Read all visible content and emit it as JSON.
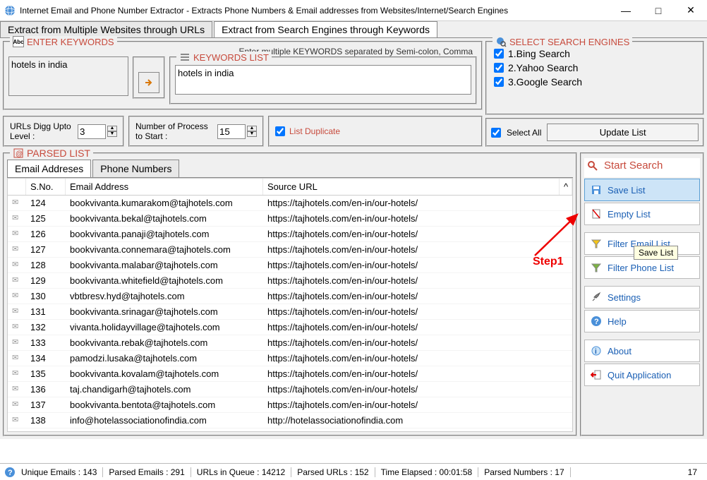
{
  "window": {
    "title": "Internet Email and Phone Number Extractor - Extracts Phone Numbers & Email addresses from Websites/Internet/Search Engines"
  },
  "mainTabs": {
    "t1": "Extract from Multiple Websites through URLs",
    "t2": "Extract from Search Engines through Keywords"
  },
  "keywords": {
    "header": "ENTER KEYWORDS",
    "note": "Enter multiple KEYWORDS separated by Semi-colon, Comma",
    "input": "hotels in india",
    "listHeader": "KEYWORDS LIST",
    "listItem": "hotels in india"
  },
  "opts": {
    "diggLabel": "URLs Digg Upto Level :",
    "diggVal": "3",
    "procLabel": "Number of Process to Start :",
    "procVal": "15",
    "dupLabel": "List Duplicate"
  },
  "engines": {
    "header": "SELECT SEARCH ENGINES",
    "e1": "1.Bing Search",
    "e2": "2.Yahoo Search",
    "e3": "3.Google Search",
    "selectAll": "Select All",
    "update": "Update List"
  },
  "parsed": {
    "header": "PARSED LIST",
    "tab1": "Email Addreses",
    "tab2": "Phone Numbers",
    "col1": "S.No.",
    "col2": "Email Address",
    "col3": "Source URL",
    "rows": [
      {
        "sno": "124",
        "email": "bookvivanta.kumarakom@tajhotels.com",
        "src": "https://tajhotels.com/en-in/our-hotels/"
      },
      {
        "sno": "125",
        "email": "bookvivanta.bekal@tajhotels.com",
        "src": "https://tajhotels.com/en-in/our-hotels/"
      },
      {
        "sno": "126",
        "email": "bookvivanta.panaji@tajhotels.com",
        "src": "https://tajhotels.com/en-in/our-hotels/"
      },
      {
        "sno": "127",
        "email": "bookvivanta.connemara@tajhotels.com",
        "src": "https://tajhotels.com/en-in/our-hotels/"
      },
      {
        "sno": "128",
        "email": "bookvivanta.malabar@tajhotels.com",
        "src": "https://tajhotels.com/en-in/our-hotels/"
      },
      {
        "sno": "129",
        "email": "bookvivanta.whitefield@tajhotels.com",
        "src": "https://tajhotels.com/en-in/our-hotels/"
      },
      {
        "sno": "130",
        "email": "vbtbresv.hyd@tajhotels.com",
        "src": "https://tajhotels.com/en-in/our-hotels/"
      },
      {
        "sno": "131",
        "email": "bookvivanta.srinagar@tajhotels.com",
        "src": "https://tajhotels.com/en-in/our-hotels/"
      },
      {
        "sno": "132",
        "email": "vivanta.holidayvillage@tajhotels.com",
        "src": "https://tajhotels.com/en-in/our-hotels/"
      },
      {
        "sno": "133",
        "email": "bookvivanta.rebak@tajhotels.com",
        "src": "https://tajhotels.com/en-in/our-hotels/"
      },
      {
        "sno": "134",
        "email": "pamodzi.lusaka@tajhotels.com",
        "src": "https://tajhotels.com/en-in/our-hotels/"
      },
      {
        "sno": "135",
        "email": "bookvivanta.kovalam@tajhotels.com",
        "src": "https://tajhotels.com/en-in/our-hotels/"
      },
      {
        "sno": "136",
        "email": "taj.chandigarh@tajhotels.com",
        "src": "https://tajhotels.com/en-in/our-hotels/"
      },
      {
        "sno": "137",
        "email": "bookvivanta.bentota@tajhotels.com",
        "src": "https://tajhotels.com/en-in/our-hotels/"
      },
      {
        "sno": "138",
        "email": "info@hotelassociationofindia.com",
        "src": "http://hotelassociationofindia.com"
      }
    ]
  },
  "actions": {
    "start": "Start Search",
    "save": "Save List",
    "empty": "Empty List",
    "filterEmail": "Filter Email List",
    "filterPhone": "Filter Phone List",
    "settings": "Settings",
    "help": "Help",
    "about": "About",
    "quit": "Quit Application",
    "tooltip": "Save List"
  },
  "annot": {
    "step1": "Step1"
  },
  "status": {
    "unique": "Unique Emails :  143",
    "parsedE": "Parsed Emails :   291",
    "queue": "URLs in Queue :  14212",
    "parsedU": "Parsed URLs :  152",
    "time": "Time Elapsed :   00:01:58",
    "parsedN": "Parsed Numbers :  17",
    "right": "17"
  }
}
